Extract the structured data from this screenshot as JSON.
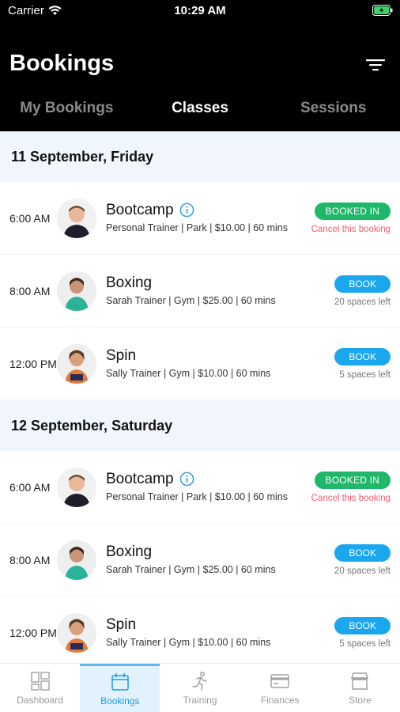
{
  "status": {
    "carrier": "Carrier",
    "time": "10:29 AM"
  },
  "header": {
    "title": "Bookings"
  },
  "tabs": [
    {
      "label": "My Bookings",
      "active": false
    },
    {
      "label": "Classes",
      "active": true
    },
    {
      "label": "Sessions",
      "active": false
    }
  ],
  "days": [
    {
      "date": "11 September, Friday",
      "classes": [
        {
          "time": "6:00 AM",
          "name": "Bootcamp",
          "info_icon": true,
          "details": "Personal Trainer | Park | $10.00 | 60 mins",
          "action": "BOOKED IN",
          "sub": "Cancel this booking",
          "state": "booked"
        },
        {
          "time": "8:00 AM",
          "name": "Boxing",
          "info_icon": false,
          "details": "Sarah Trainer | Gym | $25.00 | 60 mins",
          "action": "BOOK",
          "sub": "20 spaces left",
          "state": "book"
        },
        {
          "time": "12:00 PM",
          "name": "Spin",
          "info_icon": false,
          "details": "Sally Trainer | Gym | $10.00 | 60 mins",
          "action": "BOOK",
          "sub": "5 spaces left",
          "state": "book"
        }
      ]
    },
    {
      "date": "12 September, Saturday",
      "classes": [
        {
          "time": "6:00 AM",
          "name": "Bootcamp",
          "info_icon": true,
          "details": "Personal Trainer | Park | $10.00 | 60 mins",
          "action": "BOOKED IN",
          "sub": "Cancel this booking",
          "state": "booked"
        },
        {
          "time": "8:00 AM",
          "name": "Boxing",
          "info_icon": false,
          "details": "Sarah Trainer | Gym | $25.00 | 60 mins",
          "action": "BOOK",
          "sub": "20 spaces left",
          "state": "book"
        },
        {
          "time": "12:00 PM",
          "name": "Spin",
          "info_icon": false,
          "details": "Sally Trainer | Gym | $10.00 | 60 mins",
          "action": "BOOK",
          "sub": "5 spaces left",
          "state": "book"
        }
      ]
    }
  ],
  "nav": [
    {
      "label": "Dashboard",
      "icon": "dashboard-icon",
      "active": false
    },
    {
      "label": "Bookings",
      "icon": "calendar-icon",
      "active": true
    },
    {
      "label": "Training",
      "icon": "running-icon",
      "active": false
    },
    {
      "label": "Finances",
      "icon": "credit-card-icon",
      "active": false
    },
    {
      "label": "Store",
      "icon": "store-icon",
      "active": false
    }
  ],
  "colors": {
    "booked": "#1fb86a",
    "book": "#1ba7ee",
    "cancel": "#f25c6f",
    "accent": "#1b9be3"
  }
}
